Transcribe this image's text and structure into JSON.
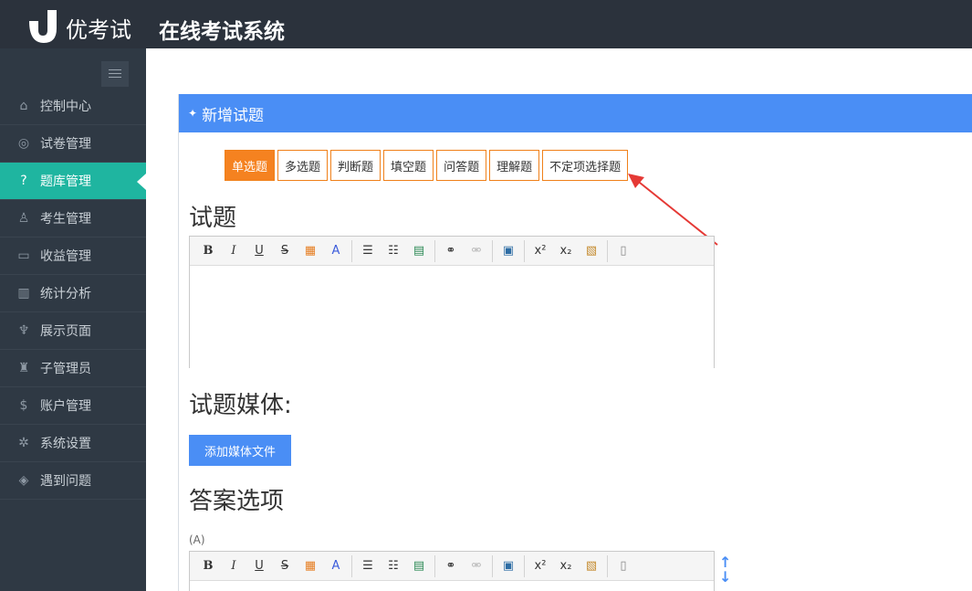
{
  "header": {
    "brand": "优考试",
    "system_title": "在线考试系统"
  },
  "sidebar": {
    "items": [
      {
        "label": "控制中心",
        "icon": "home-icon",
        "glyph": "⌂"
      },
      {
        "label": "试卷管理",
        "icon": "check-circle-icon",
        "glyph": "◎"
      },
      {
        "label": "题库管理",
        "icon": "question-circle-icon",
        "glyph": "?"
      },
      {
        "label": "考生管理",
        "icon": "user-icon",
        "glyph": "♙"
      },
      {
        "label": "收益管理",
        "icon": "card-icon",
        "glyph": "▭"
      },
      {
        "label": "统计分析",
        "icon": "bar-chart-icon",
        "glyph": "▥"
      },
      {
        "label": "展示页面",
        "icon": "tree-icon",
        "glyph": "♆"
      },
      {
        "label": "子管理员",
        "icon": "admin-icon",
        "glyph": "♜"
      },
      {
        "label": "账户管理",
        "icon": "dollar-icon",
        "glyph": "$"
      },
      {
        "label": "系统设置",
        "icon": "gear-icon",
        "glyph": "✲"
      },
      {
        "label": "遇到问题",
        "icon": "tag-icon",
        "glyph": "◈"
      }
    ],
    "active_index": 2
  },
  "panel": {
    "title": "新增试题",
    "tabs": [
      "单选题",
      "多选题",
      "判断题",
      "填空题",
      "问答题",
      "理解题",
      "不定项选择题"
    ],
    "active_tab": 0,
    "question_heading": "试题",
    "media_heading": "试题媒体:",
    "add_media_button": "添加媒体文件",
    "options_heading": "答案选项",
    "option_a_label": "(A)"
  },
  "colors": {
    "accent": "#4a8ef5",
    "active_nav": "#1fb5a0",
    "tab_orange": "#f58220",
    "annotation_arrow": "#e53935"
  }
}
